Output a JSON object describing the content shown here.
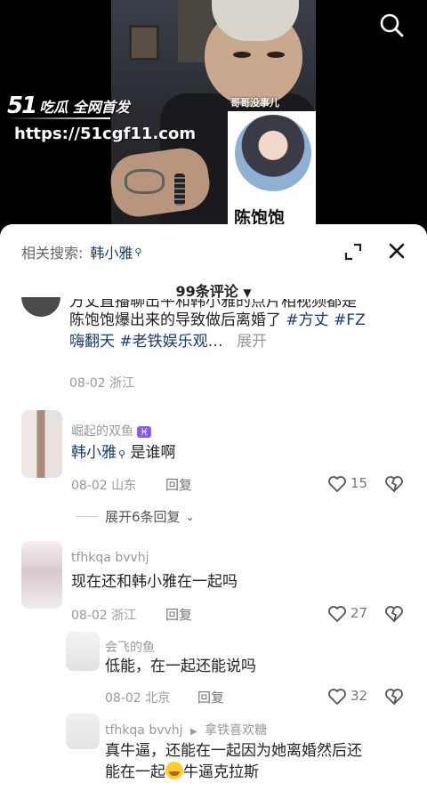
{
  "video": {
    "caption_small": "哥哥没事儿",
    "card_name": "陈饱饱",
    "logo_number": "51",
    "logo_text": "吃瓜 全网首发",
    "url": "https://51cgf11.com"
  },
  "sheet": {
    "related_label": "相关搜索:",
    "related_keyword": "韩小雅",
    "comment_count": "99条评论"
  },
  "comments": [
    {
      "text_line1": "方丈直播聊出平和韩小雅的点片相视频都是",
      "text_line2": "陈饱饱爆出来的导致做后离婚了 ",
      "tag1": "#方丈",
      "tag2": "#FZ",
      "text_line3": "嗨翻天 ",
      "tag3": "#老铁娱乐观…",
      "more": "展开",
      "meta": "08-02 浙江"
    },
    {
      "username": "崛起的双鱼",
      "badge": "♓",
      "keyword": "韩小雅",
      "text": "是谁啊",
      "meta": "08-02 山东",
      "reply": "回复",
      "likes": "15",
      "expand": "展开6条回复"
    },
    {
      "username": "tfhkqa bvvhj",
      "text": "现在还和韩小雅在一起吗",
      "meta": "08-02 浙江",
      "reply": "回复",
      "likes": "27"
    },
    {
      "username": "会飞的鱼",
      "text": "低能，在一起还能说吗",
      "meta": "08-02 北京",
      "reply": "回复",
      "likes": "32"
    },
    {
      "username": "tfhkqa bvvhj",
      "reply_to": "拿铁喜欢糖",
      "text_line1": "真牛逼，还能在一起因为她离婚然后还",
      "text_line2": "能在一起",
      "text_line2b": "牛逼克拉斯"
    }
  ],
  "colors": {
    "link": "#1a3b6e",
    "meta": "#999999"
  }
}
